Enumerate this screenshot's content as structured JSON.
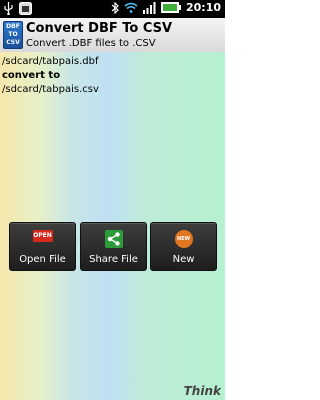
{
  "status_bar": {
    "time": "20:10",
    "icons": [
      "usb-icon",
      "notification-icon",
      "bluetooth-icon",
      "wifi-icon",
      "signal-icon",
      "battery-icon"
    ]
  },
  "header": {
    "icon_text": [
      "DBF",
      "TO",
      "CSV"
    ],
    "title": "Convert DBF To CSV",
    "subtitle": "Convert .DBF files to .CSV"
  },
  "content": {
    "source_path": "/sdcard/tabpais.dbf",
    "convert_label": "convert to",
    "dest_path": "/sdcard/tabpais.csv"
  },
  "buttons": [
    {
      "label": "Open File",
      "icon": "open-icon",
      "icon_text": "OPEN"
    },
    {
      "label": "Share File",
      "icon": "share-icon"
    },
    {
      "label": "New",
      "icon": "new-icon",
      "icon_text": "NEW"
    }
  ],
  "footer": {
    "logo": "Think"
  },
  "colors": {
    "status_bar": "#000000",
    "open_icon": "#d6291c",
    "share_icon": "#2e9b3a",
    "new_icon": "#e0771f"
  }
}
